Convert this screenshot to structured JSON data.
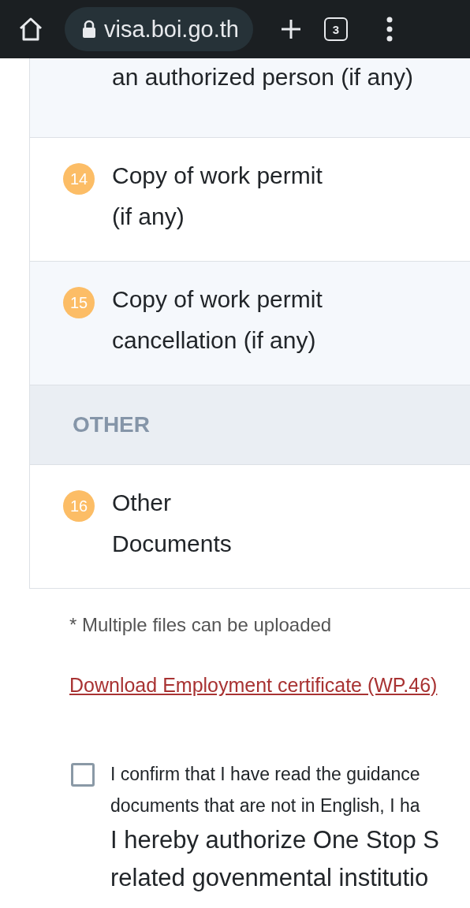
{
  "browser_bar": {
    "url": "visa.boi.go.th",
    "tab_count": "3"
  },
  "documents": [
    {
      "kind": "item",
      "title": "an authorized person (if any)"
    },
    {
      "kind": "item",
      "number": "14",
      "title": "Copy of work permit\n(if any)"
    },
    {
      "kind": "item",
      "number": "15",
      "title": "Copy of work permit\ncancellation (if any)"
    },
    {
      "kind": "section",
      "title": "OTHER"
    },
    {
      "kind": "item",
      "number": "16",
      "title": "Other\nDocuments"
    }
  ],
  "note": "* Multiple files can be uploaded",
  "download_link": "Download Employment certificate (WP.46)",
  "consent": {
    "checked": false,
    "lines": [
      "I confirm that I have read the guidance",
      "documents that are not in English, I ha"
    ],
    "authorization": [
      "I hereby authorize One Stop S",
      "related govenmental institutio"
    ]
  }
}
